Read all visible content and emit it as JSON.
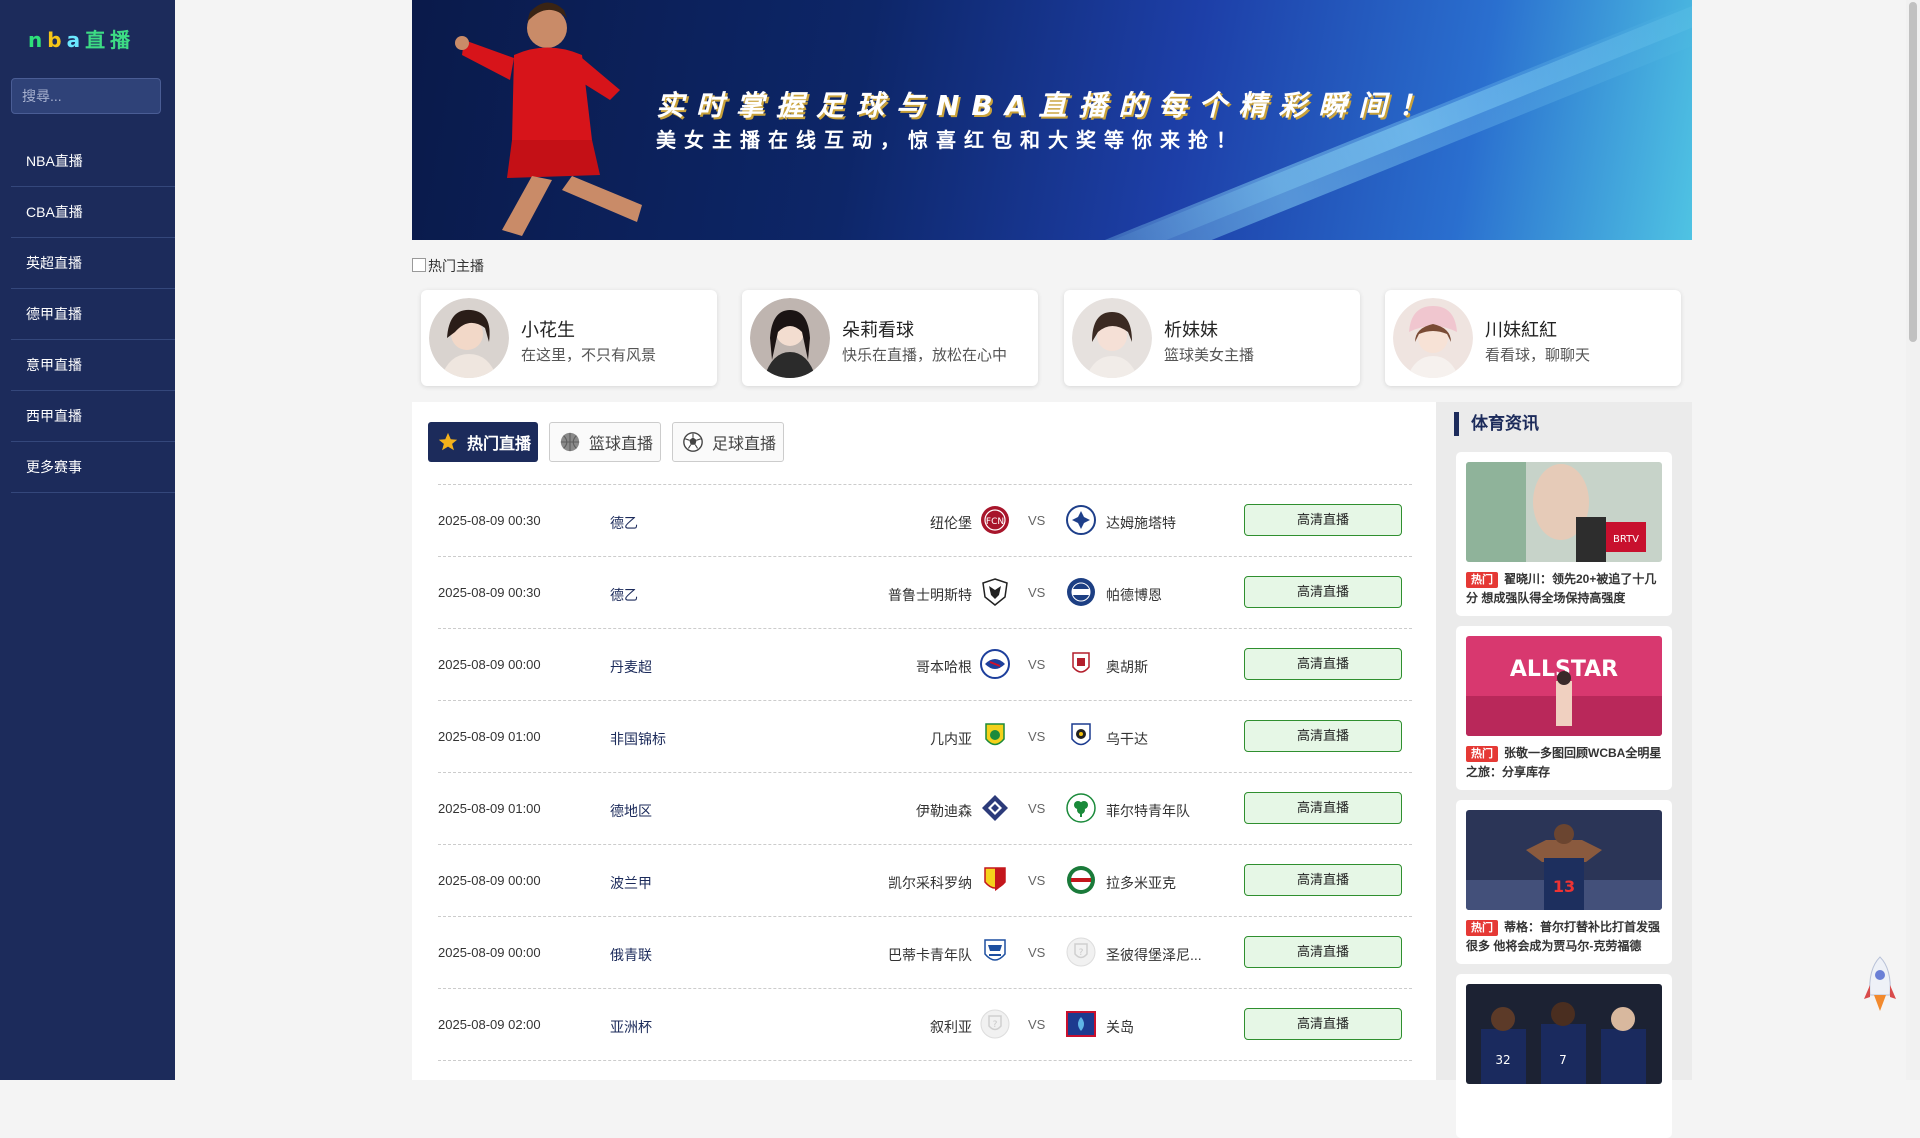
{
  "sidebar": {
    "logo": [
      "n",
      "b",
      "a",
      "直播"
    ],
    "search_placeholder": "搜尋...",
    "items": [
      {
        "label": "NBA直播"
      },
      {
        "label": "CBA直播"
      },
      {
        "label": "英超直播"
      },
      {
        "label": "德甲直播"
      },
      {
        "label": "意甲直播"
      },
      {
        "label": "西甲直播"
      },
      {
        "label": "更多赛事"
      }
    ]
  },
  "banner": {
    "headline": "实时掌握足球与NBA直播的每个精彩瞬间！",
    "subline": "美女主播在线互动，惊喜红包和大奖等你来抢！"
  },
  "hot": {
    "title": "热门主播",
    "anchors": [
      {
        "name": "小花生",
        "desc": "在这里，不只有风景"
      },
      {
        "name": "朵莉看球",
        "desc": "快乐在直播，放松在心中"
      },
      {
        "name": "析妹妹",
        "desc": "篮球美女主播"
      },
      {
        "name": "川妹紅紅",
        "desc": "看看球，聊聊天"
      }
    ]
  },
  "tabs": [
    {
      "label": "热门直播",
      "icon": "star-icon"
    },
    {
      "label": "篮球直播",
      "icon": "basketball-icon"
    },
    {
      "label": "足球直播",
      "icon": "soccer-ball-icon"
    }
  ],
  "matches": [
    {
      "time": "2025-08-09 00:30",
      "league": "德乙",
      "home": "纽伦堡",
      "vs": "VS",
      "away": "达姆施塔特",
      "button": "高清直播"
    },
    {
      "time": "2025-08-09 00:30",
      "league": "德乙",
      "home": "普鲁士明斯特",
      "vs": "VS",
      "away": "帕德博恩",
      "button": "高清直播"
    },
    {
      "time": "2025-08-09 00:00",
      "league": "丹麦超",
      "home": "哥本哈根",
      "vs": "VS",
      "away": "奥胡斯",
      "button": "高清直播"
    },
    {
      "time": "2025-08-09 01:00",
      "league": "非国锦标",
      "home": "几内亚",
      "vs": "VS",
      "away": "乌干达",
      "button": "高清直播"
    },
    {
      "time": "2025-08-09 01:00",
      "league": "德地区",
      "home": "伊勒迪森",
      "vs": "VS",
      "away": "菲尔特青年队",
      "button": "高清直播"
    },
    {
      "time": "2025-08-09 00:00",
      "league": "波兰甲",
      "home": "凯尔采科罗纳",
      "vs": "VS",
      "away": "拉多米亚克",
      "button": "高清直播"
    },
    {
      "time": "2025-08-09 00:00",
      "league": "俄青联",
      "home": "巴蒂卡青年队",
      "vs": "VS",
      "away": "圣彼得堡泽尼...",
      "button": "高清直播"
    },
    {
      "time": "2025-08-09 02:00",
      "league": "亚洲杯",
      "home": "叙利亚",
      "vs": "VS",
      "away": "关岛",
      "button": "高清直播"
    }
  ],
  "news": {
    "title": "体育资讯",
    "items": [
      {
        "tag": "热门",
        "text": "翟晓川：领先20+被追了十几分 想成强队得全场保持高强度"
      },
      {
        "tag": "热门",
        "text": "张敬一多图回顾WCBA全明星之旅：分享库存"
      },
      {
        "tag": "热门",
        "text": "蒂格：普尔打替补比打首发强很多 他将会成为贾马尔-克劳福德"
      },
      {
        "tag": "",
        "text": ""
      }
    ]
  },
  "colors": {
    "sidebar_bg": "#1c2b5b",
    "accent": "#1c2b5b",
    "live_button_border": "#2f8f2f",
    "live_button_bg": "#e6f7e6",
    "hot_tag": "#e53935"
  }
}
